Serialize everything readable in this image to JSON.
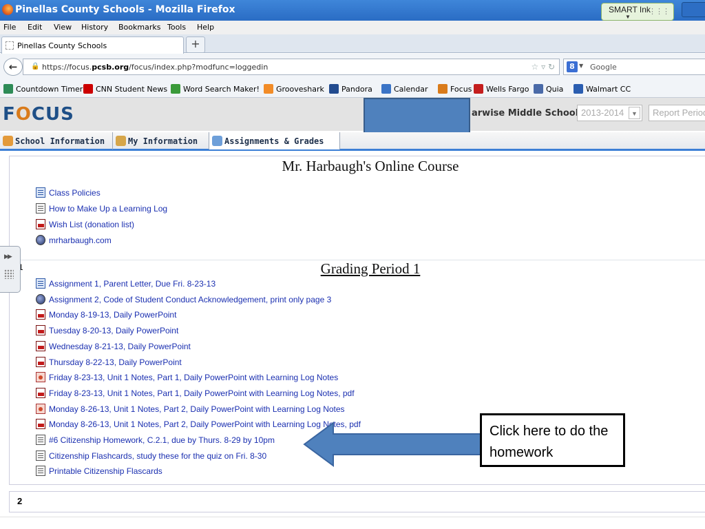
{
  "browser": {
    "window_title": "Pinellas County Schools - Mozilla Firefox",
    "smart_ink_label": "SMART Ink",
    "menu": [
      "File",
      "Edit",
      "View",
      "History",
      "Bookmarks",
      "Tools",
      "Help"
    ],
    "tab_title": "Pinellas County Schools",
    "new_tab_label": "+",
    "url_prefix": "https://focus.",
    "url_domain": "pcsb.org",
    "url_path": "/focus/index.php?modfunc=loggedin",
    "search_placeholder": "Google",
    "bookmarks": [
      {
        "label": "Countdown Timer",
        "icon": "countdown-timer-icon",
        "color": "#2e8b57"
      },
      {
        "label": "CNN Student News",
        "icon": "cnn-icon",
        "color": "#cc0000"
      },
      {
        "label": "Word Search Maker!",
        "icon": "word-search-icon",
        "color": "#3a9a3a"
      },
      {
        "label": "Grooveshark",
        "icon": "grooveshark-icon",
        "color": "#f28c28"
      },
      {
        "label": "Pandora",
        "icon": "pandora-icon",
        "color": "#224b8f"
      },
      {
        "label": "Calendar",
        "icon": "calendar-icon",
        "color": "#3b74c6"
      },
      {
        "label": "Focus",
        "icon": "focus-icon",
        "color": "#d97b1b"
      },
      {
        "label": "Wells Fargo",
        "icon": "wells-fargo-icon",
        "color": "#c41e1e"
      },
      {
        "label": "Quia",
        "icon": "quia-icon",
        "color": "#4a6aa8"
      },
      {
        "label": "Walmart CC",
        "icon": "walmart-icon",
        "color": "#2a5db0"
      }
    ]
  },
  "focus": {
    "logo_f": "F",
    "logo_o": "O",
    "logo_rest": "CUS",
    "school_name": "arwise Middle School",
    "year_value": "2013-2014",
    "report_value": "Report Period",
    "nav_tabs": [
      {
        "label": "School Information",
        "icon": "school-icon"
      },
      {
        "label": "My Information",
        "icon": "people-icon"
      },
      {
        "label": "Assignments & Grades",
        "icon": "grades-icon"
      }
    ]
  },
  "content": {
    "course_title": "Mr. Harbaugh's Online Course",
    "top_items": [
      {
        "label": "Class Policies",
        "icon": "word"
      },
      {
        "label": "How to Make Up a Learning Log",
        "icon": "doc"
      },
      {
        "label": "Wish List (donation list)",
        "icon": "pdf"
      },
      {
        "label": "mrharbaugh.com",
        "icon": "link"
      }
    ],
    "section_number": "1",
    "grading_period_title": "Grading Period 1",
    "gp_items": [
      {
        "label": "Assignment 1, Parent Letter, Due Fri. 8-23-13",
        "icon": "word"
      },
      {
        "label": "Assignment 2, Code of Student Conduct Acknowledgement, print only page 3",
        "icon": "link"
      },
      {
        "label": "Monday 8-19-13, Daily PowerPoint",
        "icon": "pdf"
      },
      {
        "label": "Tuesday 8-20-13, Daily PowerPoint",
        "icon": "pdf"
      },
      {
        "label": "Wednesday 8-21-13, Daily PowerPoint",
        "icon": "pdf"
      },
      {
        "label": "Thursday 8-22-13, Daily PowerPoint",
        "icon": "pdf"
      },
      {
        "label": "Friday 8-23-13, Unit 1 Notes, Part 1, Daily PowerPoint with Learning Log Notes",
        "icon": "ppt"
      },
      {
        "label": "Friday 8-23-13, Unit 1 Notes, Part 1, Daily PowerPoint with Learning Log Notes, pdf",
        "icon": "pdf"
      },
      {
        "label": "Monday 8-26-13, Unit 1 Notes, Part 2, Daily PowerPoint with Learning Log Notes",
        "icon": "ppt"
      },
      {
        "label": "Monday 8-26-13, Unit 1 Notes, Part 2, Daily PowerPoint with Learning Log Notes, pdf",
        "icon": "pdf"
      },
      {
        "label": "#6 Citizenship Homework, C.2.1, due by Thurs. 8-29 by 10pm",
        "icon": "doc"
      },
      {
        "label": "Citizenship Flashcards, study these for the quiz on Fri. 8-30",
        "icon": "doc"
      },
      {
        "label": "Printable Citizenship Flascards",
        "icon": "doc"
      }
    ],
    "page_number": "2"
  },
  "annotation": {
    "callout_text": "Click here to do the homework",
    "arrow_color": "#4f81bd"
  }
}
